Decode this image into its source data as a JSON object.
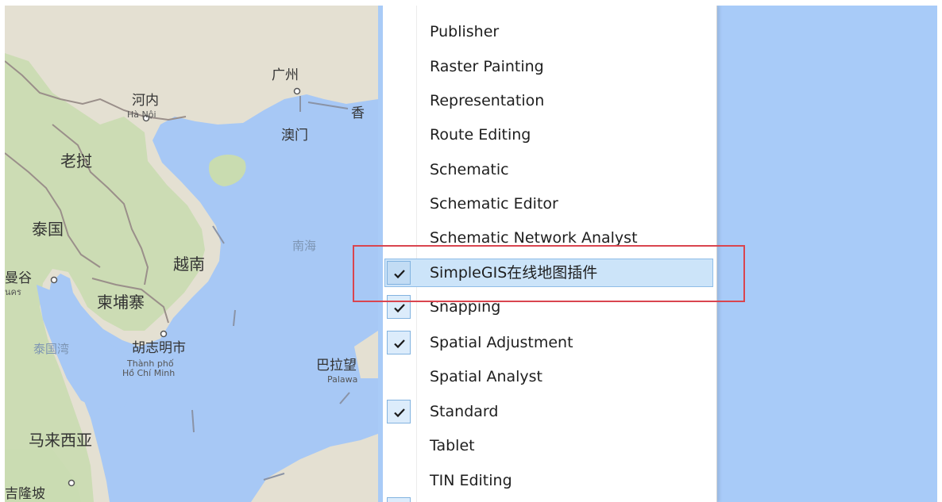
{
  "map": {
    "places": {
      "guangzhou": "广州",
      "hanoi": "河内",
      "hanoi_latin": "Hà Nội",
      "hongkong_partial": "香",
      "macau": "澳门",
      "laos": "老挝",
      "thailand": "泰国",
      "south_china_sea": "南海",
      "vietnam": "越南",
      "bangkok_partial": "曼谷",
      "bangkok_thai_partial": "นคร",
      "cambodia": "柬埔寨",
      "gulf_of_thailand": "泰国湾",
      "hcmc": "胡志明市",
      "hcmc_latin_1": "Thành phố",
      "hcmc_latin_2": "Hồ Chí Minh",
      "palawan": "巴拉望",
      "palawan_latin_partial": "Palawa",
      "malaysia": "马来西亚",
      "bottom_partial": "吉隆坡"
    },
    "colors": {
      "sea": "#a7c8f5",
      "land": "#e4e0d2",
      "forest": "#c6dcae",
      "border": "#9a8f8a"
    }
  },
  "menu": {
    "items": [
      {
        "label": "Publisher",
        "checked": false
      },
      {
        "label": "Raster Painting",
        "checked": false
      },
      {
        "label": "Representation",
        "checked": false
      },
      {
        "label": "Route Editing",
        "checked": false
      },
      {
        "label": "Schematic",
        "checked": false
      },
      {
        "label": "Schematic Editor",
        "checked": false
      },
      {
        "label": "Schematic Network Analyst",
        "checked": false
      },
      {
        "label": "SimpleGIS在线地图插件",
        "checked": true,
        "selected": true
      },
      {
        "label": "Snapping",
        "checked": true
      },
      {
        "label": "Spatial Adjustment",
        "checked": true
      },
      {
        "label": "Spatial Analyst",
        "checked": false
      },
      {
        "label": "Standard",
        "checked": true
      },
      {
        "label": "Tablet",
        "checked": false
      },
      {
        "label": "TIN Editing",
        "checked": false
      }
    ]
  },
  "annotation": {
    "color": "#d9454f"
  }
}
